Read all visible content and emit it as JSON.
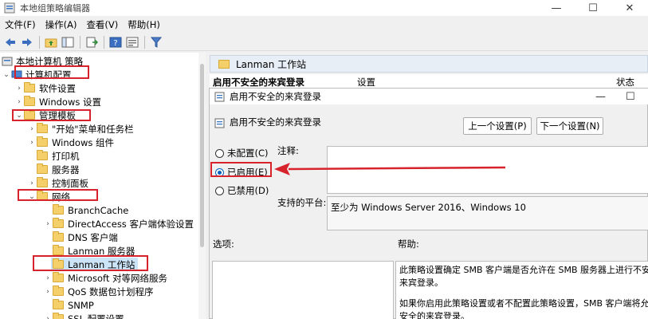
{
  "window": {
    "title": "本地组策略编辑器",
    "minimize": "—",
    "maximize": "☐",
    "close": "✕"
  },
  "menu": [
    "文件(F)",
    "操作(A)",
    "查看(V)",
    "帮助(H)"
  ],
  "toolbar": {
    "icons": [
      "back-icon",
      "forward-icon",
      "up-folder-icon",
      "show-tree-icon",
      "export-icon",
      "help-icon",
      "properties-icon",
      "filter-icon"
    ]
  },
  "tree": {
    "root": "本地计算机 策略",
    "computer_config": "计算机配置",
    "software_settings": "软件设置",
    "windows_settings": "Windows 设置",
    "admin_templates": "管理模板",
    "start_menu": "\"开始\"菜单和任务栏",
    "windows_components": "Windows 组件",
    "printers": "打印机",
    "server": "服务器",
    "control_panel": "控制面板",
    "network": "网络",
    "branchcache": "BranchCache",
    "directaccess": "DirectAccess 客户端体验设置",
    "dns_client": "DNS 客户端",
    "lanman_server": "Lanman 服务器",
    "lanman_workstation": "Lanman 工作站",
    "ms_peer": "Microsoft 对等网络服务",
    "qos": "QoS 数据包计划程序",
    "snmp": "SNMP",
    "ssl": "SSL 配置设置"
  },
  "right_panel": {
    "header": "Lanman 工作站",
    "selected_setting": "启用不安全的来宾登录",
    "col_setting": "设置",
    "col_status": "状态"
  },
  "dialog": {
    "title": "启用不安全的来宾登录",
    "setting_name": "启用不安全的来宾登录",
    "prev_button": "上一个设置(P)",
    "next_button": "下一个设置(N)",
    "options": [
      {
        "label": "未配置(C)",
        "selected": false
      },
      {
        "label": "已启用(E)",
        "selected": true
      },
      {
        "label": "已禁用(D)",
        "selected": false
      }
    ],
    "comment_label": "注释:",
    "comment_value": "",
    "supported_label": "支持的平台:",
    "supported_value": "至少为 Windows Server 2016、Windows 10",
    "options_label": "选项:",
    "help_label": "帮助:",
    "help_line1": "此策略设置确定 SMB 客户端是否允许在 SMB 服务器上进行不安全的",
    "help_line2": "来宾登录。",
    "help_line3": "如果你启用此策略设置或者不配置此策略设置，SMB 客户端将允许不",
    "help_line4": "安全的来宾登录。"
  },
  "colors": {
    "highlight": "#d6232c",
    "selection": "#cce4f7",
    "folder": "#f5cf6a",
    "radio_on": "#005fb8"
  }
}
